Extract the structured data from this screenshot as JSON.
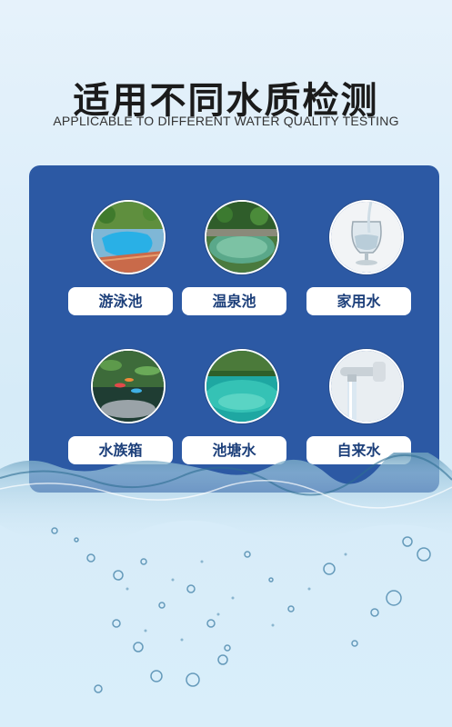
{
  "header": {
    "title": "适用不同水质检测",
    "subtitle": "APPLICABLE TO DIFFERENT WATER QUALITY TESTING"
  },
  "items": [
    {
      "label": "游泳池",
      "icon": "swimming-pool-photo"
    },
    {
      "label": "温泉池",
      "icon": "hot-spring-photo"
    },
    {
      "label": "家用水",
      "icon": "drinking-glass-photo"
    },
    {
      "label": "水族箱",
      "icon": "aquarium-photo"
    },
    {
      "label": "池塘水",
      "icon": "pond-photo"
    },
    {
      "label": "自来水",
      "icon": "faucet-photo"
    }
  ],
  "colors": {
    "panel": "#2c59a4",
    "label_text": "#1c3f7a",
    "background": "#e6f2fb"
  }
}
